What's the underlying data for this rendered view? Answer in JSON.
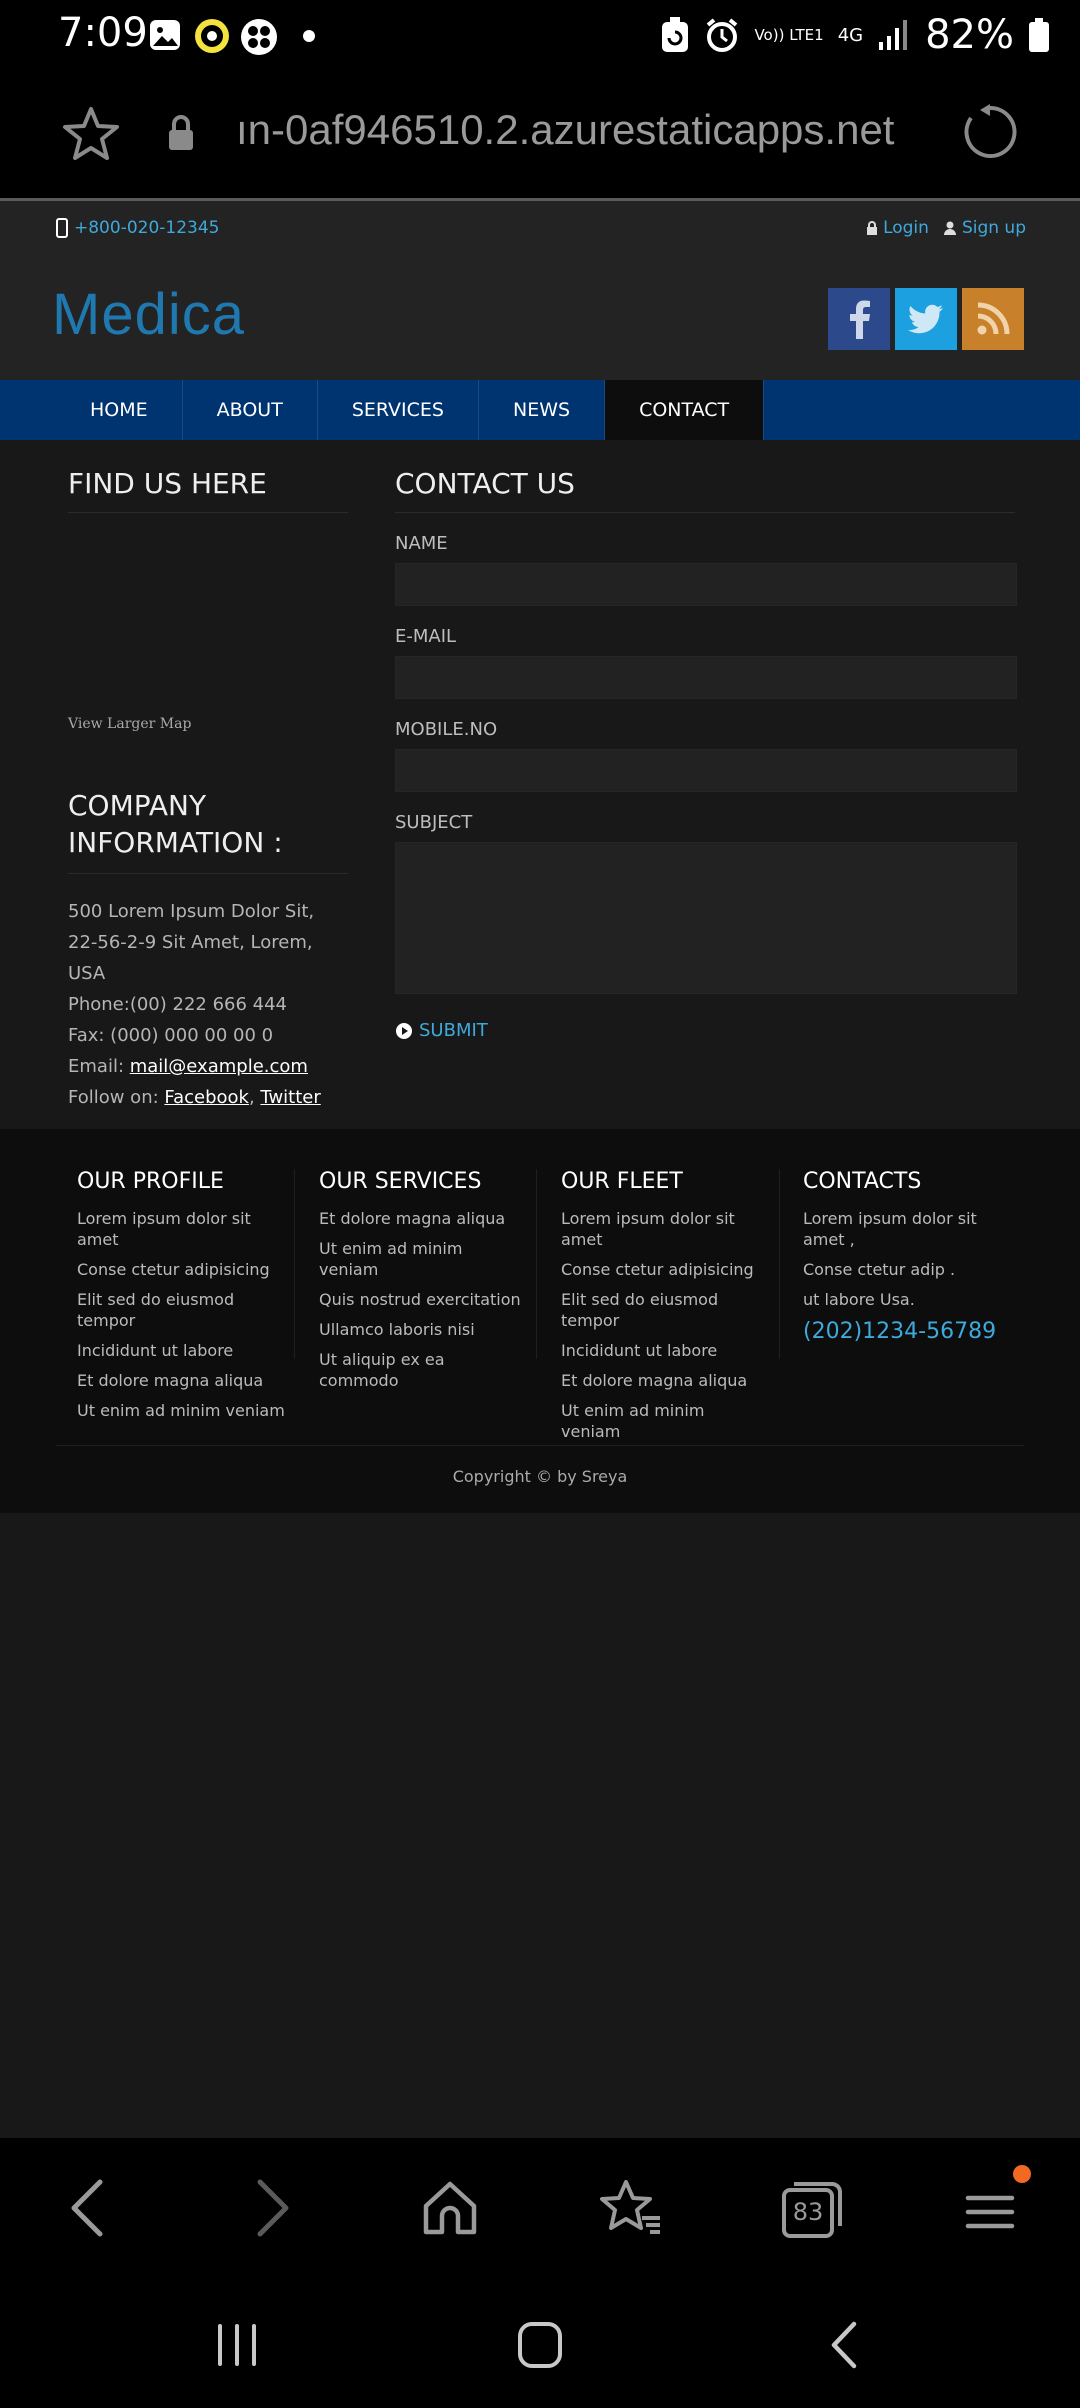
{
  "status_bar": {
    "time": "7:09",
    "network": "Vo)) LTE1",
    "signal": "4G",
    "battery": "82%"
  },
  "browser": {
    "url": "ın-0af946510.2.azurestaticapps.net",
    "tab_count": "83"
  },
  "topbar": {
    "phone": "+800-020-12345",
    "login": "Login",
    "signup": "Sign up"
  },
  "header": {
    "logo": "Medica"
  },
  "nav": {
    "items": [
      "HOME",
      "ABOUT",
      "SERVICES",
      "NEWS",
      "CONTACT"
    ],
    "active": "CONTACT"
  },
  "find_us": {
    "title": "FIND US HERE",
    "map_link": "View Larger Map"
  },
  "company": {
    "title": "COMPANY INFORMATION :",
    "address": "500 Lorem Ipsum Dolor Sit, 22-56-2-9 Sit Amet, Lorem, USA",
    "phone": "Phone:(00) 222 666 444",
    "fax": "Fax: (000) 000 00 00 0",
    "email_label": "Email: ",
    "email": "mail@example.com",
    "follow_label": "Follow on: ",
    "facebook": "Facebook",
    "twitter": "Twitter"
  },
  "contact_form": {
    "title": "CONTACT US",
    "name_label": "NAME",
    "email_label": "E-MAIL",
    "mobile_label": "MOBILE.NO",
    "subject_label": "SUBJECT",
    "submit": "SUBMIT"
  },
  "footer": {
    "profile": {
      "title": "OUR PROFILE",
      "items": [
        "Lorem ipsum dolor sit amet",
        "Conse ctetur adipisicing",
        "Elit sed do eiusmod tempor",
        "Incididunt ut labore",
        "Et dolore magna aliqua",
        "Ut enim ad minim veniam"
      ]
    },
    "services": {
      "title": "OUR SERVICES",
      "items": [
        "Et dolore magna aliqua",
        "Ut enim ad minim veniam",
        "Quis nostrud exercitation",
        "Ullamco laboris nisi",
        "Ut aliquip ex ea commodo"
      ]
    },
    "fleet": {
      "title": "OUR FLEET",
      "items": [
        "Lorem ipsum dolor sit amet",
        "Conse ctetur adipisicing",
        "Elit sed do eiusmod tempor",
        "Incididunt ut labore",
        "Et dolore magna aliqua",
        "Ut enim ad minim veniam"
      ]
    },
    "contacts": {
      "title": "CONTACTS",
      "items": [
        "Lorem ipsum dolor sit amet ,",
        "Conse ctetur adip .",
        "ut labore Usa."
      ],
      "phone": "(202)1234-56789"
    },
    "copyright": "Copyright © by Sreya"
  },
  "colors": {
    "accent": "#3fa9dc",
    "nav_bg": "#003470",
    "logo": "#1f78b0",
    "facebook": "#2c4a8b",
    "twitter": "#1da0df",
    "rss": "#c9802a",
    "notification_dot": "#f26a21"
  }
}
